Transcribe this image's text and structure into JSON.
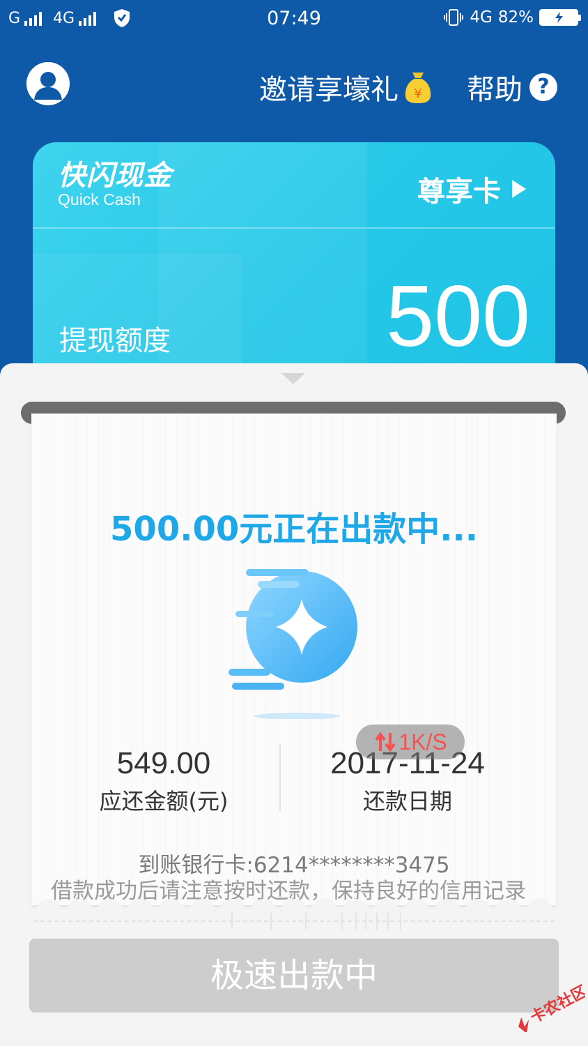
{
  "status_bar": {
    "carrier1": "G",
    "carrier2": "4G",
    "time": "07:49",
    "net_right": "4G",
    "battery": "82%"
  },
  "header": {
    "invite_label": "邀请享壕礼",
    "help_label": "帮助",
    "help_glyph": "?"
  },
  "card": {
    "brand_cn": "快闪现金",
    "brand_en": "Quick Cash",
    "tier_label": "尊享卡",
    "limit_label": "提现额度",
    "limit_value": "500"
  },
  "receipt": {
    "status": "500.00元正在出款中...",
    "repay_amount": "549.00",
    "repay_amount_label": "应还金额(元)",
    "repay_date": "2017-11-24",
    "repay_date_label": "还款日期",
    "speed": "1K/S",
    "bank_card": "到账银行卡:6214********3475",
    "notice": "借款成功后请注意按时还款，保持良好的信用记录"
  },
  "action": {
    "label": "极速出款中"
  },
  "watermark": {
    "text": "卡农社区"
  },
  "colors": {
    "header_bg": "#0f5aa8",
    "card_bg": "#27c8e8",
    "accent": "#1fa8e8",
    "button_disabled": "#cdcdcd"
  }
}
